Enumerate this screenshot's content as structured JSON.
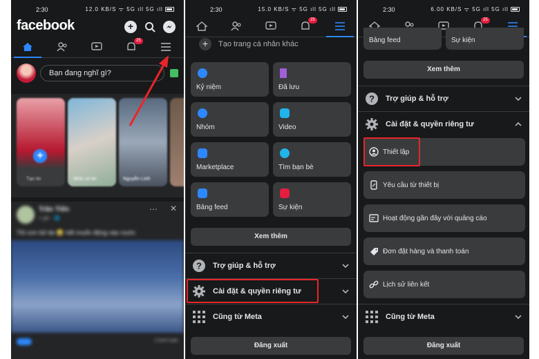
{
  "status_bar": {
    "time": "2:30",
    "icons_p1": "12.0 KB/S ᯤ 5G ıll 5G ıll",
    "icons_p2": "15.0 KB/S ᯤ 5G ıll 5G ıll",
    "icons_p3": "6.00 KB/S ᯤ 5G ıll 5G ıll"
  },
  "header": {
    "logo": "facebook"
  },
  "tabs": {
    "notification_badge": "25"
  },
  "composer": {
    "placeholder": "Bạn đang nghĩ gì?"
  },
  "stories": [
    {
      "label": "Tạo tin"
    },
    {
      "label": "Nhìn có tin"
    },
    {
      "label": "Nguyễn Linh"
    }
  ],
  "post": {
    "author": "Trần Tiến",
    "time": "1 giờ · 🌐",
    "text": "Tôi cơn bỏ tài 😂 hết muốn động vào nước",
    "comments": "2 bình luận"
  },
  "menu": {
    "create_profile": "Tạo trang cá nhân khác",
    "cards": [
      {
        "label": "Kỷ niệm",
        "color": "#2d88ff"
      },
      {
        "label": "Đã lưu",
        "color": "#a05ed8"
      },
      {
        "label": "Nhóm",
        "color": "#2d88ff"
      },
      {
        "label": "Video",
        "color": "#1fb5ea"
      },
      {
        "label": "Marketplace",
        "color": "#2d88ff"
      },
      {
        "label": "Tìm bạn bè",
        "color": "#1fb5ea"
      },
      {
        "label": "Bảng feed",
        "color": "#2d88ff"
      },
      {
        "label": "Sự kiện",
        "color": "#e41e3f"
      }
    ],
    "see_more": "Xem thêm",
    "help_section": "Trợ giúp & hỗ trợ",
    "settings_section": "Cài đặt & quyền riêng tư",
    "meta_section": "Cũng từ Meta",
    "logout": "Đăng xuất"
  },
  "settings_list": [
    {
      "label": "Thiết lập",
      "icon": "profile-settings-icon"
    },
    {
      "label": "Yêu cầu từ thiết bị",
      "icon": "device-request-icon"
    },
    {
      "label": "Hoạt động gần đây với quảng cáo",
      "icon": "ad-activity-icon"
    },
    {
      "label": "Đơn đặt hàng và thanh toán",
      "icon": "payment-tag-icon"
    },
    {
      "label": "Lịch sử liên kết",
      "icon": "link-history-icon"
    }
  ],
  "colors": {
    "accent": "#2d88ff",
    "highlight": "#e8262a",
    "background": "#18191a",
    "card": "#3a3b3c"
  }
}
